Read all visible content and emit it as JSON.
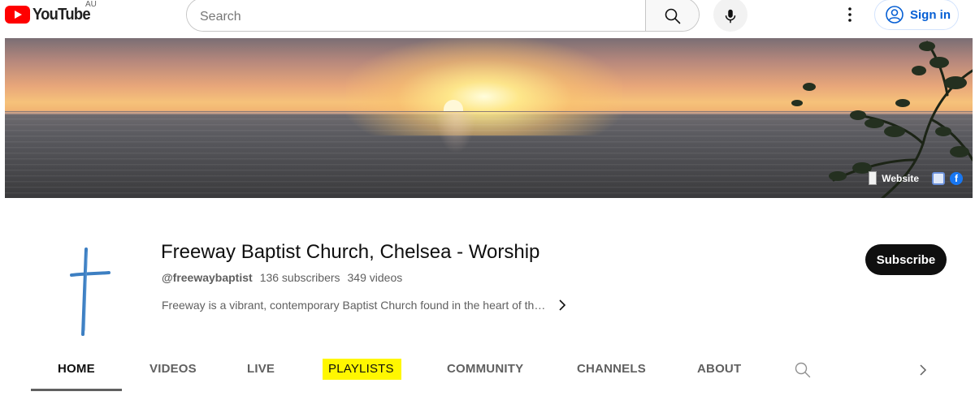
{
  "masthead": {
    "logo_text": "YouTube",
    "country_code": "AU",
    "search_placeholder": "Search",
    "signin_label": "Sign in",
    "icons": [
      "youtube-logo-icon",
      "search-icon",
      "microphone-icon",
      "more-vert-icon",
      "account-circle-icon"
    ]
  },
  "banner": {
    "links": [
      {
        "label": "Website",
        "icon": "website-favicon-icon"
      },
      {
        "label": "",
        "icon": "globe-favicon-icon"
      },
      {
        "label": "",
        "icon": "facebook-icon"
      }
    ]
  },
  "channel": {
    "name": "Freeway Baptist Church, Chelsea - Worship",
    "handle": "@freewaybaptist",
    "subscribers": "136 subscribers",
    "videos": "349 videos",
    "description": "Freeway is a vibrant, contemporary Baptist Church found in the heart of th…",
    "subscribe_label": "Subscribe",
    "avatar_icon": "cross-avatar-icon"
  },
  "tabs": [
    {
      "label": "HOME",
      "active": true
    },
    {
      "label": "VIDEOS",
      "active": false
    },
    {
      "label": "LIVE",
      "active": false
    },
    {
      "label": "PLAYLISTS",
      "active": false,
      "highlighted": true
    },
    {
      "label": "COMMUNITY",
      "active": false
    },
    {
      "label": "CHANNELS",
      "active": false
    },
    {
      "label": "ABOUT",
      "active": false
    }
  ],
  "colors": {
    "brand_red": "#ff0000",
    "link_blue": "#065fd4",
    "highlight_yellow": "#fff700",
    "subscribe_bg": "#0f0f0f"
  }
}
